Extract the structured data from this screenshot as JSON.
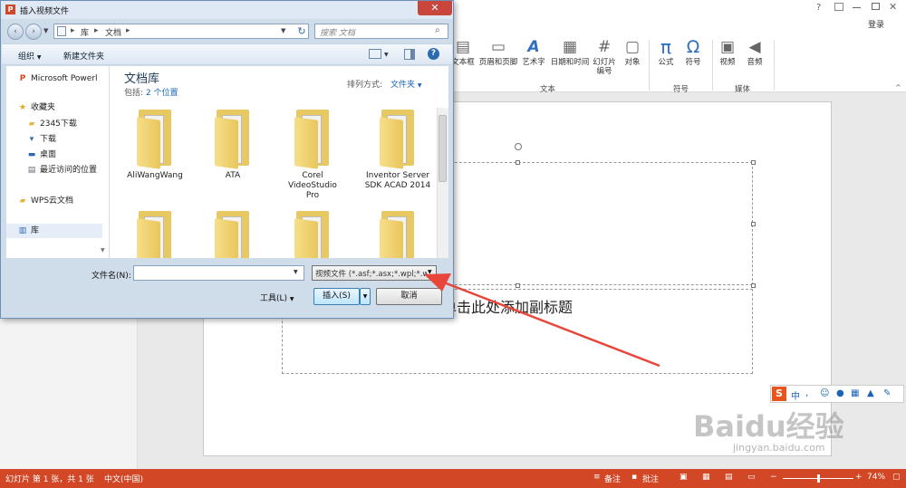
{
  "ppt": {
    "help_icon": "?",
    "login_label": "登录",
    "ribbon": {
      "buttons": [
        {
          "label": "文本框",
          "icon": "textbox-icon"
        },
        {
          "label": "页眉和页脚",
          "icon": "header-footer-icon"
        },
        {
          "label": "艺术字",
          "icon": "wordart-icon"
        },
        {
          "label": "日期和时间",
          "icon": "datetime-icon"
        },
        {
          "label": "幻灯片\n编号",
          "icon": "slide-number-icon"
        },
        {
          "label": "对象",
          "icon": "object-icon"
        },
        {
          "label": "公式",
          "icon": "equation-icon"
        },
        {
          "label": "符号",
          "icon": "symbol-icon"
        },
        {
          "label": "视频",
          "icon": "video-icon"
        },
        {
          "label": "音频",
          "icon": "audio-icon"
        }
      ],
      "groups": [
        "文本",
        "符号",
        "媒体"
      ]
    },
    "slide": {
      "subtitle_text": "单击此处添加副标题"
    },
    "status": {
      "slide_info": "幻灯片 第 1 张，共 1 张",
      "language": "中文(中国)",
      "notes": "备注",
      "comments": "批注",
      "zoom": "74%"
    },
    "ime": {
      "lang": "中"
    }
  },
  "dialog": {
    "title": "插入视频文件",
    "close_glyph": "✕",
    "breadcrumb": [
      "库",
      "文档"
    ],
    "search_placeholder": "搜索 文档",
    "toolbar": {
      "organize": "组织",
      "new_folder": "新建文件夹"
    },
    "nav": [
      {
        "label": "Microsoft Powerl",
        "icon": "powerpoint-icon"
      },
      {
        "label": "收藏夹",
        "icon": "star-icon"
      },
      {
        "label": "2345下载",
        "icon": "folder-icon"
      },
      {
        "label": "下载",
        "icon": "download-icon"
      },
      {
        "label": "桌面",
        "icon": "desktop-icon"
      },
      {
        "label": "最近访问的位置",
        "icon": "recent-icon"
      },
      {
        "label": "WPS云文档",
        "icon": "folder-icon"
      },
      {
        "label": "库",
        "icon": "library-icon"
      }
    ],
    "library": {
      "title": "文档库",
      "includes_label": "包括:",
      "includes_link": "2 个位置",
      "sort_label": "排列方式:",
      "sort_value": "文件夹"
    },
    "folders": [
      "AliWangWang",
      "ATA",
      "Corel\nVideoStudio\nPro",
      "Inventor Server\nSDK ACAD 2014",
      "",
      "",
      "",
      ""
    ],
    "filename_label": "文件名(N):",
    "filename_value": "",
    "filetype_value": "视频文件 (*.asf;*.asx;*.wpl;*.wi",
    "tools_label": "工具(L)",
    "insert_label": "插入(S)",
    "cancel_label": "取消"
  },
  "watermark": {
    "main": "Baidu经验",
    "sub": "jingyan.baidu.com"
  }
}
